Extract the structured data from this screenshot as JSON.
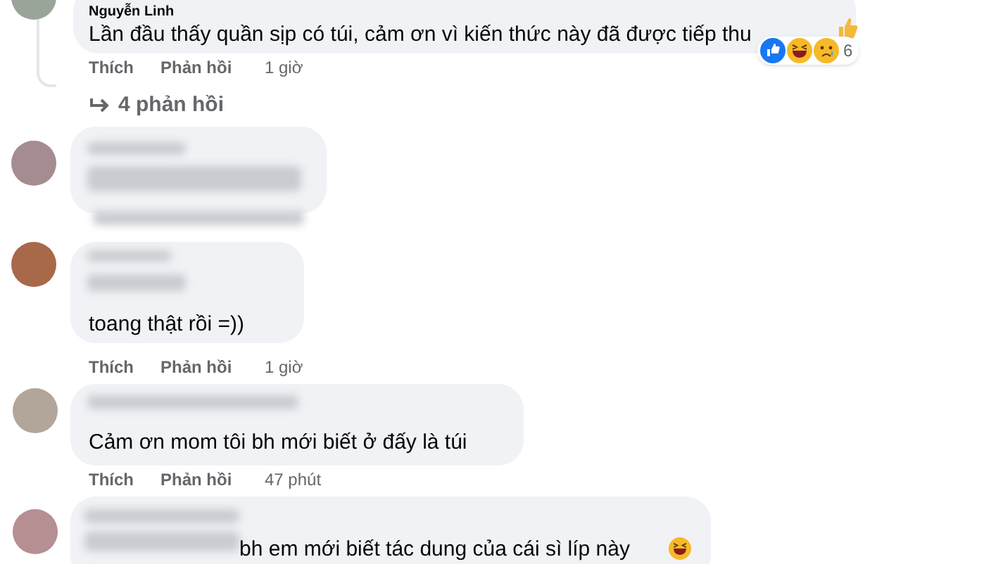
{
  "comments": [
    {
      "author": "Nguyễn Linh",
      "text": "Lần đầu thấy quần sịp có túi, cảm ơn vì kiến thức này đã được tiếp thu",
      "like_label": "Thích",
      "reply_label": "Phản hồi",
      "time": "1 giờ",
      "reaction_count": "6",
      "replies_link": "4 phản hồi"
    },
    {
      "text": "toang thật rồi =))",
      "like_label": "Thích",
      "reply_label": "Phản hồi",
      "time": "1 giờ"
    },
    {
      "text": "Cảm ơn mom tôi bh mới biết ở đấy là túi",
      "like_label": "Thích",
      "reply_label": "Phản hồi",
      "time": "47 phút"
    },
    {
      "text": "bh em mới biết tác dung của cái sì líp này"
    }
  ]
}
